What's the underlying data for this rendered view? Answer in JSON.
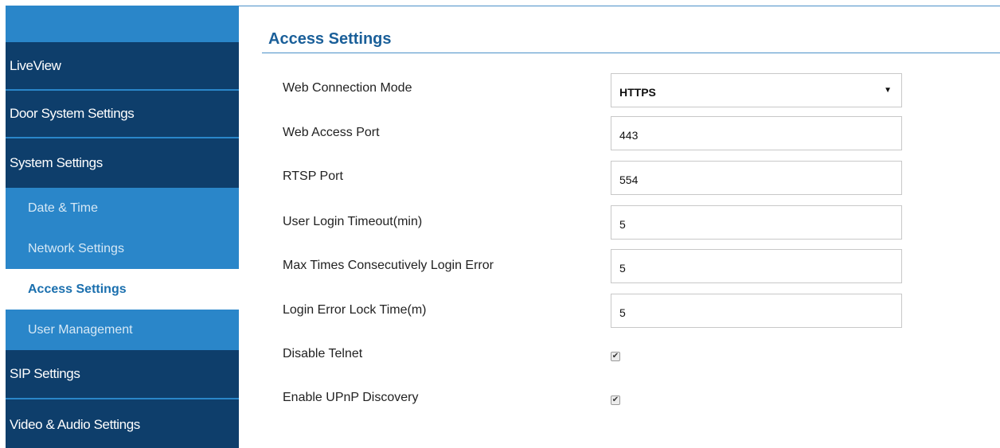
{
  "sidebar": {
    "items": [
      {
        "label": "LiveView"
      },
      {
        "label": "Door System Settings"
      },
      {
        "label": "System Settings"
      },
      {
        "label": "Date & Time"
      },
      {
        "label": "Network Settings"
      },
      {
        "label": "Access Settings"
      },
      {
        "label": "User Management"
      },
      {
        "label": "SIP Settings"
      },
      {
        "label": "Video & Audio Settings"
      }
    ],
    "active_item": "Access Settings"
  },
  "page": {
    "title": "Access Settings"
  },
  "form": {
    "web_connection_mode": {
      "label": "Web Connection Mode",
      "value": "HTTPS"
    },
    "web_access_port": {
      "label": "Web Access Port",
      "value": "443"
    },
    "rtsp_port": {
      "label": "RTSP Port",
      "value": "554"
    },
    "login_timeout": {
      "label": "User Login Timeout(min)",
      "value": "5"
    },
    "max_login_error": {
      "label": "Max Times Consecutively Login Error",
      "value": "5"
    },
    "lock_time": {
      "label": "Login Error Lock Time(m)",
      "value": "5"
    },
    "disable_telnet": {
      "label": "Disable Telnet",
      "checked": true,
      "glyph": "✔"
    },
    "enable_upnp": {
      "label": "Enable UPnP Discovery",
      "checked": true,
      "glyph": "✔"
    }
  },
  "colors": {
    "nav_dark": "#0e3e6b",
    "nav_light": "#2a86c9",
    "title": "#1a5f99"
  }
}
